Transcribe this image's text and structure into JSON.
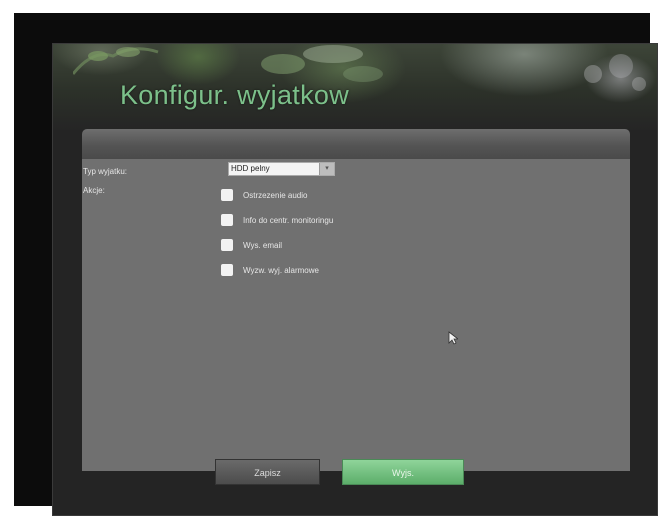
{
  "header": {
    "title": "Konfigur. wyjatkow"
  },
  "form": {
    "exception_type_label": "Typ wyjatku:",
    "exception_type_value": "HDD pelny",
    "actions_label": "Akcje:",
    "actions": [
      {
        "label": "Ostrzezenie audio",
        "checked": false
      },
      {
        "label": "Info do centr. monitoringu",
        "checked": false
      },
      {
        "label": "Wys. email",
        "checked": false
      },
      {
        "label": "Wyzw. wyj. alarmowe",
        "checked": false
      }
    ]
  },
  "buttons": {
    "save_label": "Zapisz",
    "exit_label": "Wyjs."
  },
  "colors": {
    "title": "#7cc08a",
    "exit_button": "#5cae6a",
    "content_bg": "#707070"
  }
}
